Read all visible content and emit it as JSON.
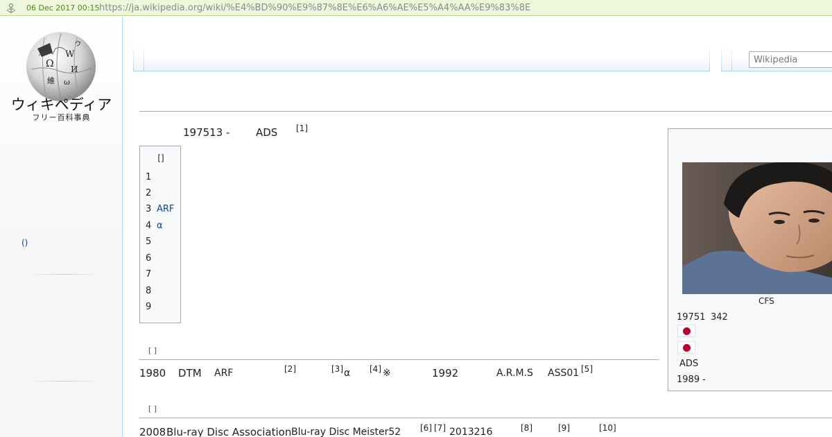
{
  "archive_bar": {
    "date": "06 Dec 2017 00:15",
    "url": "https://ja.wikipedia.org/wiki/%E4%BD%90%E9%87%8E%E6%A6%AE%E5%A4%AA%E9%83%8E"
  },
  "sidebar": {
    "logo_title": "ウィキペディア",
    "logo_subtitle": "フリー百科事典",
    "nav_link": "()"
  },
  "search": {
    "placeholder": "Wikipedia"
  },
  "lead": {
    "date_link": "197513",
    "dash": "-",
    "org": "ADS",
    "ref": "[1]"
  },
  "toc": {
    "title": "[]",
    "items": [
      {
        "num": "1",
        "label": ""
      },
      {
        "num": "2",
        "label": ""
      },
      {
        "num": "3",
        "label": "ARF"
      },
      {
        "num": "4",
        "label": "α"
      },
      {
        "num": "5",
        "label": ""
      },
      {
        "num": "6",
        "label": ""
      },
      {
        "num": "7",
        "label": ""
      },
      {
        "num": "8",
        "label": ""
      },
      {
        "num": "9",
        "label": ""
      }
    ]
  },
  "section1": {
    "edit": "[ ]",
    "year_1980": "1980",
    "dtm": "DTM",
    "arf": "ARF",
    "ref2": "[2]",
    "ref3": "[3]",
    "alpha": "α",
    "ref4": "[4]",
    "kome": "※",
    "year_1992": "1992",
    "arms": "A.R.M.S",
    "ass": "ASS01",
    "ref5": "[5]"
  },
  "section2": {
    "edit": "[ ]",
    "year_2008": "2008",
    "bda": "Blu-ray Disc Association",
    "meister": "Blu-ray Disc Meister52",
    "ref6": "[6]",
    "ref7": "[7]",
    "date_2013": "2013216",
    "ref8": "[8]",
    "ref9": "[9]",
    "ref10": "[10]"
  },
  "infobox": {
    "caption": "CFS",
    "birth_link": "19751",
    "birth_rest": "342",
    "org": "ADS",
    "year_link": "1989",
    "year_dash": "-",
    "flag_color": "#bc002d"
  }
}
